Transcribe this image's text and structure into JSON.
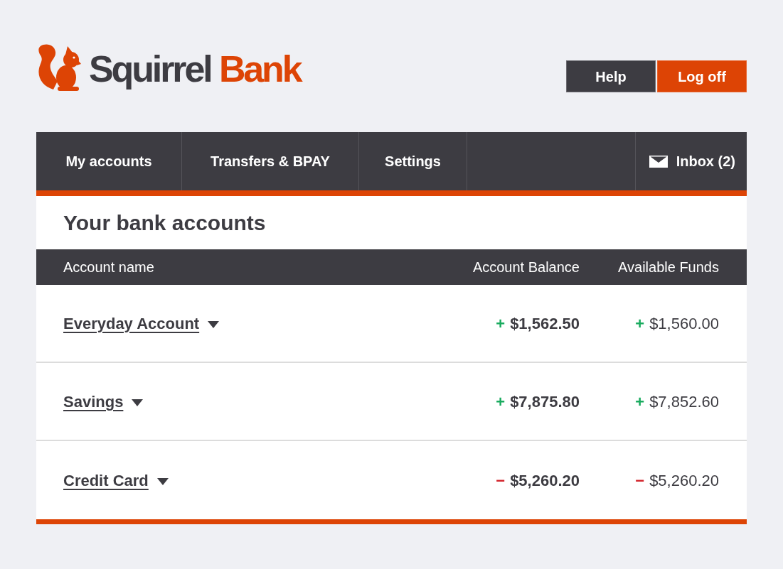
{
  "logo": {
    "words": [
      "Squirrel",
      "Bank"
    ]
  },
  "header_buttons": [
    {
      "label": "Help",
      "kind": "secondary"
    },
    {
      "label": "Log off",
      "kind": "primary"
    }
  ],
  "nav": {
    "items": [
      {
        "label": "My accounts"
      },
      {
        "label": "Transfers & BPAY"
      },
      {
        "label": "Settings"
      }
    ],
    "inbox": {
      "label": "Inbox (2)"
    }
  },
  "panel": {
    "title": "Your bank accounts"
  },
  "table": {
    "columns": [
      "Account name",
      "Account Balance",
      "Available Funds"
    ],
    "rows": [
      {
        "name": "Everyday Account",
        "balance": {
          "sign": "+",
          "amount": "$1,562.50",
          "color": "#1aab5f"
        },
        "available": {
          "sign": "+",
          "amount": "$1,560.00",
          "color": "#1aab5f"
        }
      },
      {
        "name": "Savings",
        "balance": {
          "sign": "+",
          "amount": "$7,875.80",
          "color": "#1aab5f"
        },
        "available": {
          "sign": "+",
          "amount": "$7,852.60",
          "color": "#1aab5f"
        }
      },
      {
        "name": "Credit Card",
        "balance": {
          "sign": "−",
          "amount": "$5,260.20",
          "color": "#d3232a"
        },
        "available": {
          "sign": "−",
          "amount": "$5,260.20",
          "color": "#d3232a"
        }
      }
    ]
  }
}
